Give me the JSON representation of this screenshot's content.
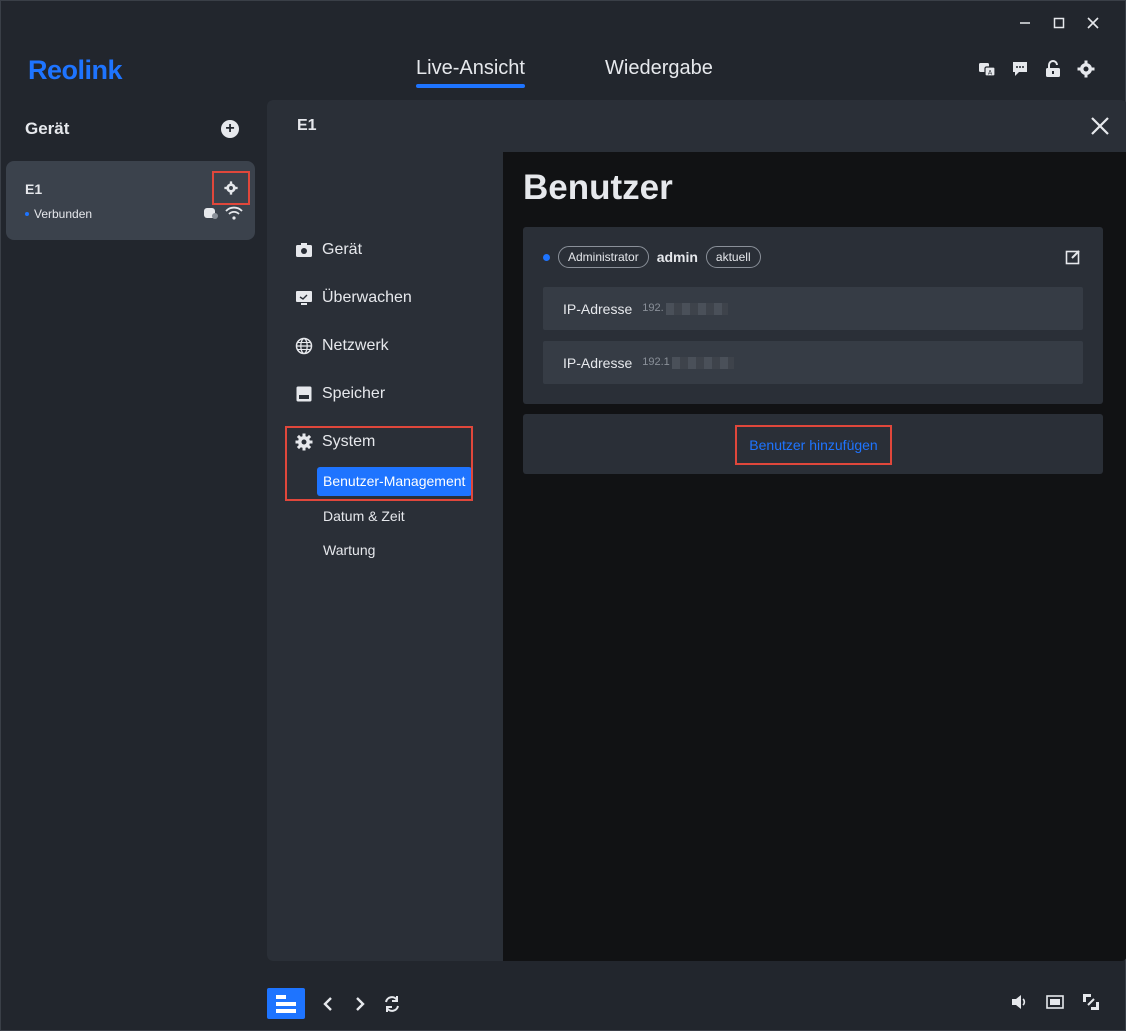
{
  "app": {
    "logo": "Reolink",
    "tabs": [
      {
        "label": "Live-Ansicht",
        "active": true
      },
      {
        "label": "Wiedergabe",
        "active": false
      }
    ],
    "top_icons": [
      "translate-icon",
      "chat-icon",
      "unlock-icon",
      "settings-icon"
    ],
    "window_controls": [
      "minimize-icon",
      "maximize-icon",
      "close-icon"
    ]
  },
  "sidebar": {
    "title": "Gerät",
    "devices": [
      {
        "name": "E1",
        "status": "Verbunden"
      }
    ]
  },
  "modal": {
    "title": "E1",
    "nav": [
      {
        "label": "Gerät",
        "icon": "camera-icon"
      },
      {
        "label": "Überwachen",
        "icon": "monitor-icon"
      },
      {
        "label": "Netzwerk",
        "icon": "globe-icon"
      },
      {
        "label": "Speicher",
        "icon": "storage-icon"
      },
      {
        "label": "System",
        "icon": "gear-icon"
      }
    ],
    "subnav": [
      {
        "label": "Benutzer-Management",
        "active": true
      },
      {
        "label": "Datum & Zeit",
        "active": false
      },
      {
        "label": "Wartung",
        "active": false
      }
    ],
    "content": {
      "title": "Benutzer",
      "user": {
        "role": "Administrator",
        "name": "admin",
        "tag": "aktuell"
      },
      "ip_rows": [
        {
          "label": "IP-Adresse",
          "value": "192."
        },
        {
          "label": "IP-Adresse",
          "value": "192.1"
        }
      ],
      "add_user_label": "Benutzer hinzufügen"
    }
  },
  "colors": {
    "accent": "#1e74ff",
    "highlight_box": "#e0473b"
  }
}
